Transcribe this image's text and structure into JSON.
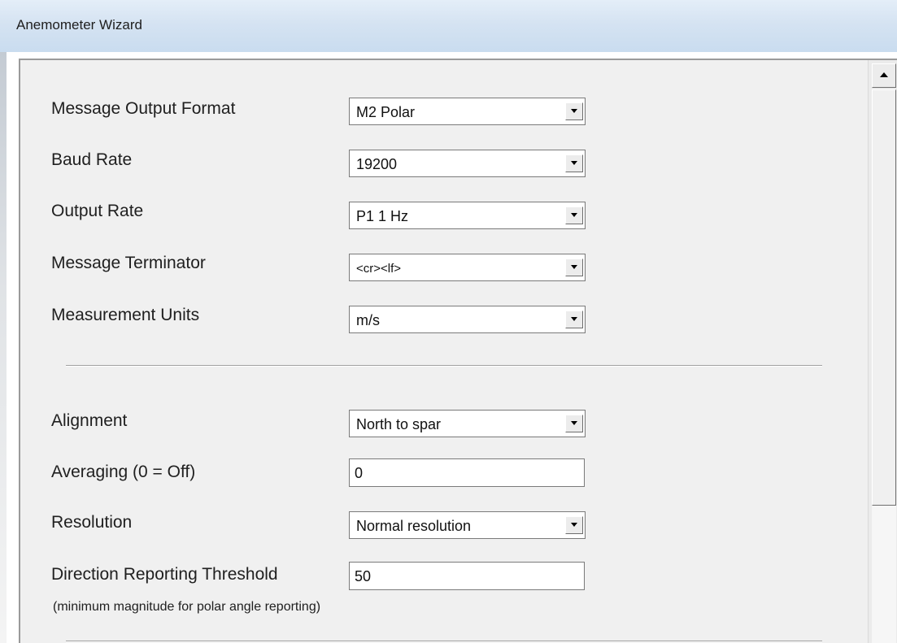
{
  "window": {
    "title": "Anemometer Wizard"
  },
  "fields": {
    "message_output_format": {
      "label": "Message Output Format",
      "value": "M2 Polar"
    },
    "baud_rate": {
      "label": "Baud Rate",
      "value": "19200"
    },
    "output_rate": {
      "label": "Output Rate",
      "value": "P1 1 Hz"
    },
    "message_terminator": {
      "label": "Message Terminator",
      "value": "<cr><lf>"
    },
    "measurement_units": {
      "label": "Measurement Units",
      "value": "m/s"
    },
    "alignment": {
      "label": "Alignment",
      "value": "North to spar"
    },
    "averaging": {
      "label": "Averaging (0 = Off)",
      "value": "0"
    },
    "resolution": {
      "label": "Resolution",
      "value": "Normal resolution"
    },
    "direction_threshold": {
      "label": "Direction Reporting Threshold",
      "value": "50",
      "hint": "(minimum magnitude for polar angle reporting)"
    }
  },
  "icons": {
    "dropdown": "chevron-down-icon",
    "scroll_up": "chevron-up-icon"
  },
  "colors": {
    "titlebar": "#d5e3f2",
    "panel": "#f0f0f0"
  }
}
